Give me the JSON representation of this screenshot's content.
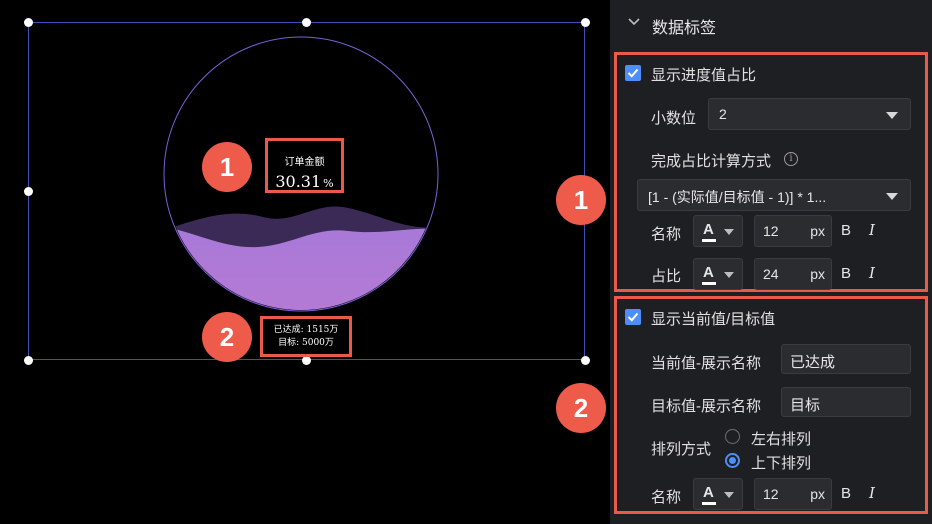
{
  "canvas": {
    "widget": {
      "name_label": "订单金额",
      "percent_value": "30.31",
      "percent_unit": "%",
      "current_line": "已达成: 1515万",
      "target_line": "目标: 5000万",
      "progress_fraction": 0.3031,
      "colors": {
        "ring": "#7b5fd6",
        "wave_front": "#a86fd4",
        "wave_back": "#3a2a55"
      }
    },
    "markers": [
      "1",
      "2"
    ]
  },
  "panel": {
    "section_title": "数据标签",
    "group1": {
      "checkbox_label": "显示进度值占比",
      "decimal_label": "小数位",
      "decimal_value": "2",
      "calc_label": "完成占比计算方式",
      "calc_value": "[1 - (实际值/目标值 - 1)] * 1...",
      "name_label": "名称",
      "name_color_glyph": "A",
      "name_size": "12",
      "ratio_label": "占比",
      "ratio_color_glyph": "A",
      "ratio_size": "24",
      "unit": "px",
      "bold_glyph": "B",
      "italic_glyph": "I"
    },
    "group2": {
      "checkbox_label": "显示当前值/目标值",
      "current_name_label": "当前值-展示名称",
      "current_name_value": "已达成",
      "target_name_label": "目标值-展示名称",
      "target_name_value": "目标",
      "layout_label": "排列方式",
      "layout_options": [
        "左右排列",
        "上下排列"
      ],
      "layout_selected": "上下排列",
      "name_label": "名称",
      "name_color_glyph": "A",
      "name_size": "12",
      "unit": "px",
      "bold_glyph": "B",
      "italic_glyph": "I"
    },
    "colors": {
      "accent": "#4e8ef7",
      "highlight": "#e85a4a"
    }
  }
}
